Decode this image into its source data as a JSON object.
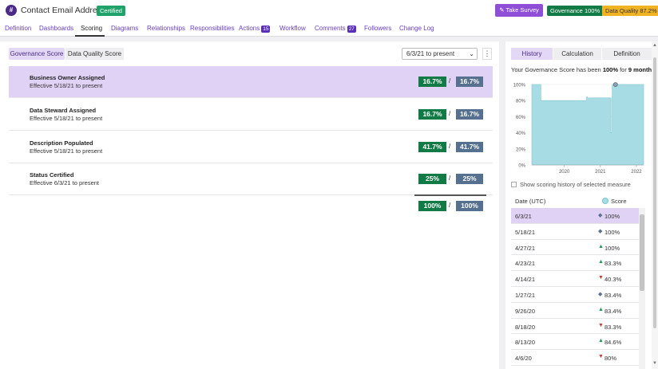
{
  "header": {
    "icon_glyph": "#",
    "title": "Contact Email Address",
    "certified_badge": "Certified",
    "take_survey_label": "Take Survey",
    "governance_badge": "Governance 100%",
    "data_quality_badge": "Data Quality 87.2%"
  },
  "tabs": [
    {
      "label": "Definition"
    },
    {
      "label": "Dashboards"
    },
    {
      "label": "Scoring",
      "active": true
    },
    {
      "label": "Diagrams"
    },
    {
      "label": "Relationships"
    },
    {
      "label": "Responsibilities"
    },
    {
      "label": "Actions",
      "count": "15"
    },
    {
      "label": "Workflow"
    },
    {
      "label": "Comments",
      "count": "27"
    },
    {
      "label": "Followers"
    },
    {
      "label": "Change Log"
    }
  ],
  "scoring": {
    "segment_governance": "Governance Score",
    "segment_data_quality": "Data Quality Score",
    "date_range": "6/3/21 to present",
    "kebab": "⋮",
    "measures": [
      {
        "name": "Business Owner Assigned",
        "effective": "Effective 5/18/21 to present",
        "score": "16.7%",
        "max": "16.7%"
      },
      {
        "name": "Data Steward Assigned",
        "effective": "Effective 5/18/21 to present",
        "score": "16.7%",
        "max": "16.7%"
      },
      {
        "name": "Description Populated",
        "effective": "Effective 5/18/21 to present",
        "score": "41.7%",
        "max": "41.7%"
      },
      {
        "name": "Status Certified",
        "effective": "Effective 6/3/21 to present",
        "score": "25%",
        "max": "25%"
      }
    ],
    "total_score": "100%",
    "total_max": "100%",
    "slash": "/"
  },
  "right_panel": {
    "tab_history": "History",
    "tab_calculation": "Calculation",
    "tab_definition": "Definition",
    "summary_prefix": "Your Governance Score has been ",
    "summary_value": "100%",
    "summary_mid": " for ",
    "summary_duration": "9 months",
    "checkbox_label": "Show scoring history of selected measure",
    "col_date": "Date (UTC)",
    "col_score": "Score",
    "history": [
      {
        "date": "6/3/21",
        "trend": "flat",
        "score": "100%",
        "selected": true
      },
      {
        "date": "5/18/21",
        "trend": "flat",
        "score": "100%"
      },
      {
        "date": "4/27/21",
        "trend": "up",
        "score": "100%"
      },
      {
        "date": "4/23/21",
        "trend": "up",
        "score": "83.3%"
      },
      {
        "date": "4/14/21",
        "trend": "down",
        "score": "40.3%"
      },
      {
        "date": "1/27/21",
        "trend": "flat",
        "score": "83.4%"
      },
      {
        "date": "9/26/20",
        "trend": "up",
        "score": "83.4%"
      },
      {
        "date": "8/18/20",
        "trend": "down",
        "score": "83.3%"
      },
      {
        "date": "8/13/20",
        "trend": "up",
        "score": "84.6%"
      },
      {
        "date": "4/6/20",
        "trend": "down",
        "score": "80%"
      }
    ]
  },
  "chart_data": {
    "type": "area",
    "y_tick_labels": [
      "0%",
      "20%",
      "40%",
      "60%",
      "80%",
      "100%"
    ],
    "x_tick_labels": [
      "2020",
      "2021",
      "2022"
    ],
    "ylim": [
      0,
      100
    ],
    "xlim": [
      2019.1,
      2022.2
    ],
    "points": [
      {
        "x": 2019.1,
        "y": 100
      },
      {
        "x": 2019.35,
        "y": 80
      },
      {
        "x": 2020.28,
        "y": 80
      },
      {
        "x": 2020.62,
        "y": 84.6
      },
      {
        "x": 2020.64,
        "y": 83.3
      },
      {
        "x": 2020.74,
        "y": 83.4
      },
      {
        "x": 2021.07,
        "y": 83.4
      },
      {
        "x": 2021.28,
        "y": 40.3
      },
      {
        "x": 2021.31,
        "y": 83.3
      },
      {
        "x": 2021.33,
        "y": 100
      },
      {
        "x": 2021.42,
        "y": 100
      },
      {
        "x": 2022.2,
        "y": 100
      }
    ],
    "highlight": {
      "x": 2021.42,
      "y": 100
    },
    "fill_color": "#a8dce4",
    "line_color": "#7cc4cf",
    "grid": true
  }
}
